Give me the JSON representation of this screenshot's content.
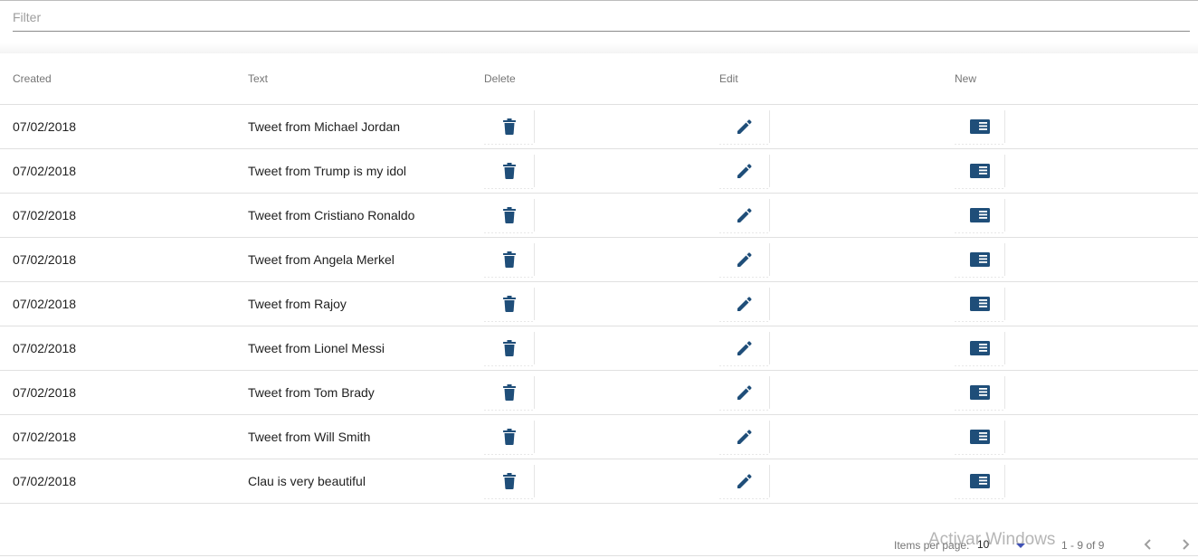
{
  "filter": {
    "placeholder": "Filter",
    "value": ""
  },
  "table": {
    "headers": {
      "created": "Created",
      "text": "Text",
      "delete": "Delete",
      "edit": "Edit",
      "new": "New"
    },
    "rows": [
      {
        "created": "07/02/2018",
        "text": "Tweet from Michael Jordan"
      },
      {
        "created": "07/02/2018",
        "text": "Tweet from Trump is my idol"
      },
      {
        "created": "07/02/2018",
        "text": "Tweet from Cristiano Ronaldo"
      },
      {
        "created": "07/02/2018",
        "text": "Tweet from Angela Merkel"
      },
      {
        "created": "07/02/2018",
        "text": "Tweet from Rajoy"
      },
      {
        "created": "07/02/2018",
        "text": "Tweet from Lionel Messi"
      },
      {
        "created": "07/02/2018",
        "text": "Tweet from Tom Brady"
      },
      {
        "created": "07/02/2018",
        "text": "Tweet from Will Smith"
      },
      {
        "created": "07/02/2018",
        "text": "Clau is very beautiful"
      }
    ]
  },
  "icons": {
    "delete": "delete-icon",
    "edit": "pencil-icon",
    "new": "new-card-icon",
    "previous": "chevron-left-icon",
    "next": "chevron-right-icon",
    "dropdown": "dropdown-arrow-icon"
  },
  "paginator": {
    "items_per_page_label": "Items per page:",
    "page_size": "10",
    "range_label": "1 - 9 of 9"
  },
  "watermark": {
    "text": "Activar Windows"
  },
  "colors": {
    "icon": "#1f4e79",
    "accent": "#3f51b5",
    "header_text": "#757575",
    "divider": "#e0e0e0"
  }
}
